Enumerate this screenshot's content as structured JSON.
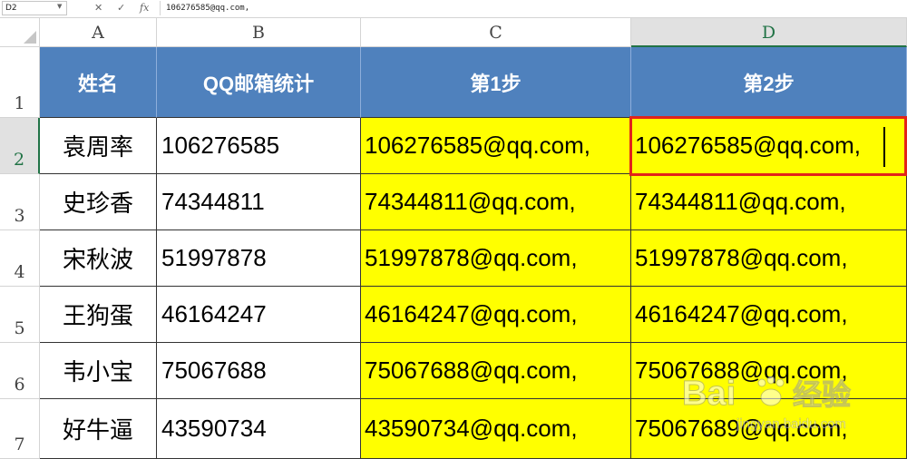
{
  "formula_bar": {
    "name_box": "D2",
    "cancel_icon": "✕",
    "enter_icon": "✓",
    "fx_label": "fx",
    "formula": "106276585@qq.com,"
  },
  "columns": [
    "A",
    "B",
    "C",
    "D"
  ],
  "rows": [
    "1",
    "2",
    "3",
    "4",
    "5",
    "6",
    "7"
  ],
  "header": {
    "name": "姓名",
    "qq": "QQ邮箱统计",
    "step1": "第1步",
    "step2": "第2步"
  },
  "data_rows": [
    {
      "name": "袁周率",
      "qq": "106276585",
      "step1": "106276585@qq.com,",
      "step2": "106276585@qq.com,"
    },
    {
      "name": "史珍香",
      "qq": "74344811",
      "step1": "74344811@qq.com,",
      "step2": "74344811@qq.com,"
    },
    {
      "name": "宋秋波",
      "qq": "51997878",
      "step1": "51997878@qq.com,",
      "step2": "51997878@qq.com,"
    },
    {
      "name": "王狗蛋",
      "qq": "46164247",
      "step1": "46164247@qq.com,",
      "step2": "46164247@qq.com,"
    },
    {
      "name": "韦小宝",
      "qq": "75067688",
      "step1": "75067688@qq.com,",
      "step2": "75067688@qq.com,"
    },
    {
      "name": "好牛逼",
      "qq": "43590734",
      "step1": "43590734@qq.com,",
      "step2": "75067689@qq.com,"
    }
  ],
  "watermark": {
    "brand": "Bai",
    "brand2": "经验",
    "url": "jingyan.baidu.com"
  },
  "colors": {
    "header_bg": "#4f81bd",
    "highlight": "#ffff00",
    "active_border": "#e2231a",
    "excel_green": "#217346"
  }
}
